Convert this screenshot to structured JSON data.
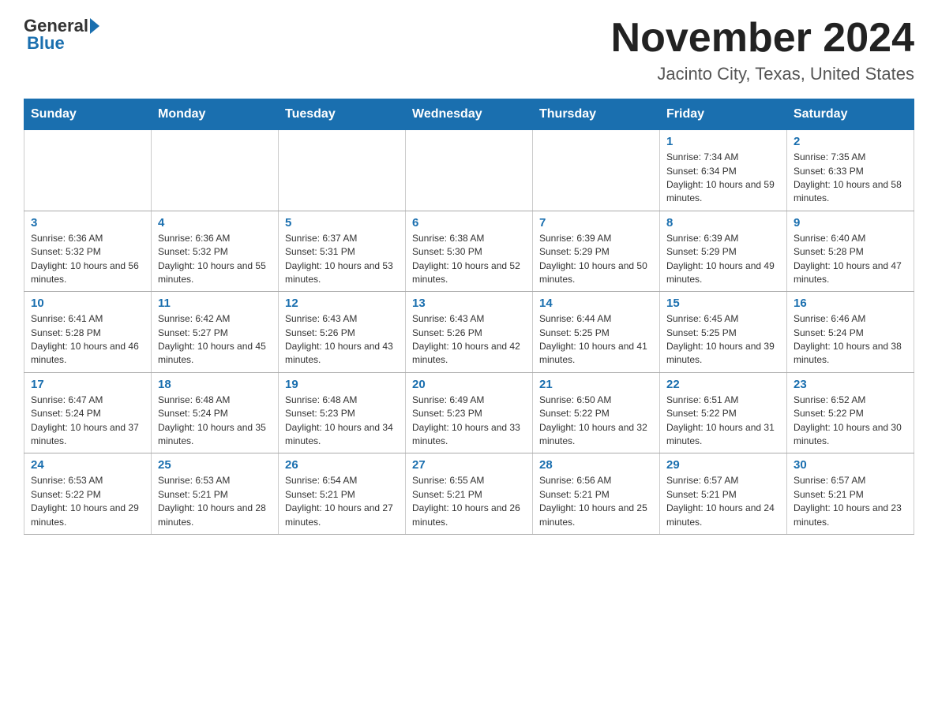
{
  "header": {
    "logo_general": "General",
    "logo_blue": "Blue",
    "month_title": "November 2024",
    "location": "Jacinto City, Texas, United States"
  },
  "weekdays": [
    "Sunday",
    "Monday",
    "Tuesday",
    "Wednesday",
    "Thursday",
    "Friday",
    "Saturday"
  ],
  "weeks": [
    [
      {
        "day": "",
        "info": ""
      },
      {
        "day": "",
        "info": ""
      },
      {
        "day": "",
        "info": ""
      },
      {
        "day": "",
        "info": ""
      },
      {
        "day": "",
        "info": ""
      },
      {
        "day": "1",
        "info": "Sunrise: 7:34 AM\nSunset: 6:34 PM\nDaylight: 10 hours and 59 minutes."
      },
      {
        "day": "2",
        "info": "Sunrise: 7:35 AM\nSunset: 6:33 PM\nDaylight: 10 hours and 58 minutes."
      }
    ],
    [
      {
        "day": "3",
        "info": "Sunrise: 6:36 AM\nSunset: 5:32 PM\nDaylight: 10 hours and 56 minutes."
      },
      {
        "day": "4",
        "info": "Sunrise: 6:36 AM\nSunset: 5:32 PM\nDaylight: 10 hours and 55 minutes."
      },
      {
        "day": "5",
        "info": "Sunrise: 6:37 AM\nSunset: 5:31 PM\nDaylight: 10 hours and 53 minutes."
      },
      {
        "day": "6",
        "info": "Sunrise: 6:38 AM\nSunset: 5:30 PM\nDaylight: 10 hours and 52 minutes."
      },
      {
        "day": "7",
        "info": "Sunrise: 6:39 AM\nSunset: 5:29 PM\nDaylight: 10 hours and 50 minutes."
      },
      {
        "day": "8",
        "info": "Sunrise: 6:39 AM\nSunset: 5:29 PM\nDaylight: 10 hours and 49 minutes."
      },
      {
        "day": "9",
        "info": "Sunrise: 6:40 AM\nSunset: 5:28 PM\nDaylight: 10 hours and 47 minutes."
      }
    ],
    [
      {
        "day": "10",
        "info": "Sunrise: 6:41 AM\nSunset: 5:28 PM\nDaylight: 10 hours and 46 minutes."
      },
      {
        "day": "11",
        "info": "Sunrise: 6:42 AM\nSunset: 5:27 PM\nDaylight: 10 hours and 45 minutes."
      },
      {
        "day": "12",
        "info": "Sunrise: 6:43 AM\nSunset: 5:26 PM\nDaylight: 10 hours and 43 minutes."
      },
      {
        "day": "13",
        "info": "Sunrise: 6:43 AM\nSunset: 5:26 PM\nDaylight: 10 hours and 42 minutes."
      },
      {
        "day": "14",
        "info": "Sunrise: 6:44 AM\nSunset: 5:25 PM\nDaylight: 10 hours and 41 minutes."
      },
      {
        "day": "15",
        "info": "Sunrise: 6:45 AM\nSunset: 5:25 PM\nDaylight: 10 hours and 39 minutes."
      },
      {
        "day": "16",
        "info": "Sunrise: 6:46 AM\nSunset: 5:24 PM\nDaylight: 10 hours and 38 minutes."
      }
    ],
    [
      {
        "day": "17",
        "info": "Sunrise: 6:47 AM\nSunset: 5:24 PM\nDaylight: 10 hours and 37 minutes."
      },
      {
        "day": "18",
        "info": "Sunrise: 6:48 AM\nSunset: 5:24 PM\nDaylight: 10 hours and 35 minutes."
      },
      {
        "day": "19",
        "info": "Sunrise: 6:48 AM\nSunset: 5:23 PM\nDaylight: 10 hours and 34 minutes."
      },
      {
        "day": "20",
        "info": "Sunrise: 6:49 AM\nSunset: 5:23 PM\nDaylight: 10 hours and 33 minutes."
      },
      {
        "day": "21",
        "info": "Sunrise: 6:50 AM\nSunset: 5:22 PM\nDaylight: 10 hours and 32 minutes."
      },
      {
        "day": "22",
        "info": "Sunrise: 6:51 AM\nSunset: 5:22 PM\nDaylight: 10 hours and 31 minutes."
      },
      {
        "day": "23",
        "info": "Sunrise: 6:52 AM\nSunset: 5:22 PM\nDaylight: 10 hours and 30 minutes."
      }
    ],
    [
      {
        "day": "24",
        "info": "Sunrise: 6:53 AM\nSunset: 5:22 PM\nDaylight: 10 hours and 29 minutes."
      },
      {
        "day": "25",
        "info": "Sunrise: 6:53 AM\nSunset: 5:21 PM\nDaylight: 10 hours and 28 minutes."
      },
      {
        "day": "26",
        "info": "Sunrise: 6:54 AM\nSunset: 5:21 PM\nDaylight: 10 hours and 27 minutes."
      },
      {
        "day": "27",
        "info": "Sunrise: 6:55 AM\nSunset: 5:21 PM\nDaylight: 10 hours and 26 minutes."
      },
      {
        "day": "28",
        "info": "Sunrise: 6:56 AM\nSunset: 5:21 PM\nDaylight: 10 hours and 25 minutes."
      },
      {
        "day": "29",
        "info": "Sunrise: 6:57 AM\nSunset: 5:21 PM\nDaylight: 10 hours and 24 minutes."
      },
      {
        "day": "30",
        "info": "Sunrise: 6:57 AM\nSunset: 5:21 PM\nDaylight: 10 hours and 23 minutes."
      }
    ]
  ]
}
